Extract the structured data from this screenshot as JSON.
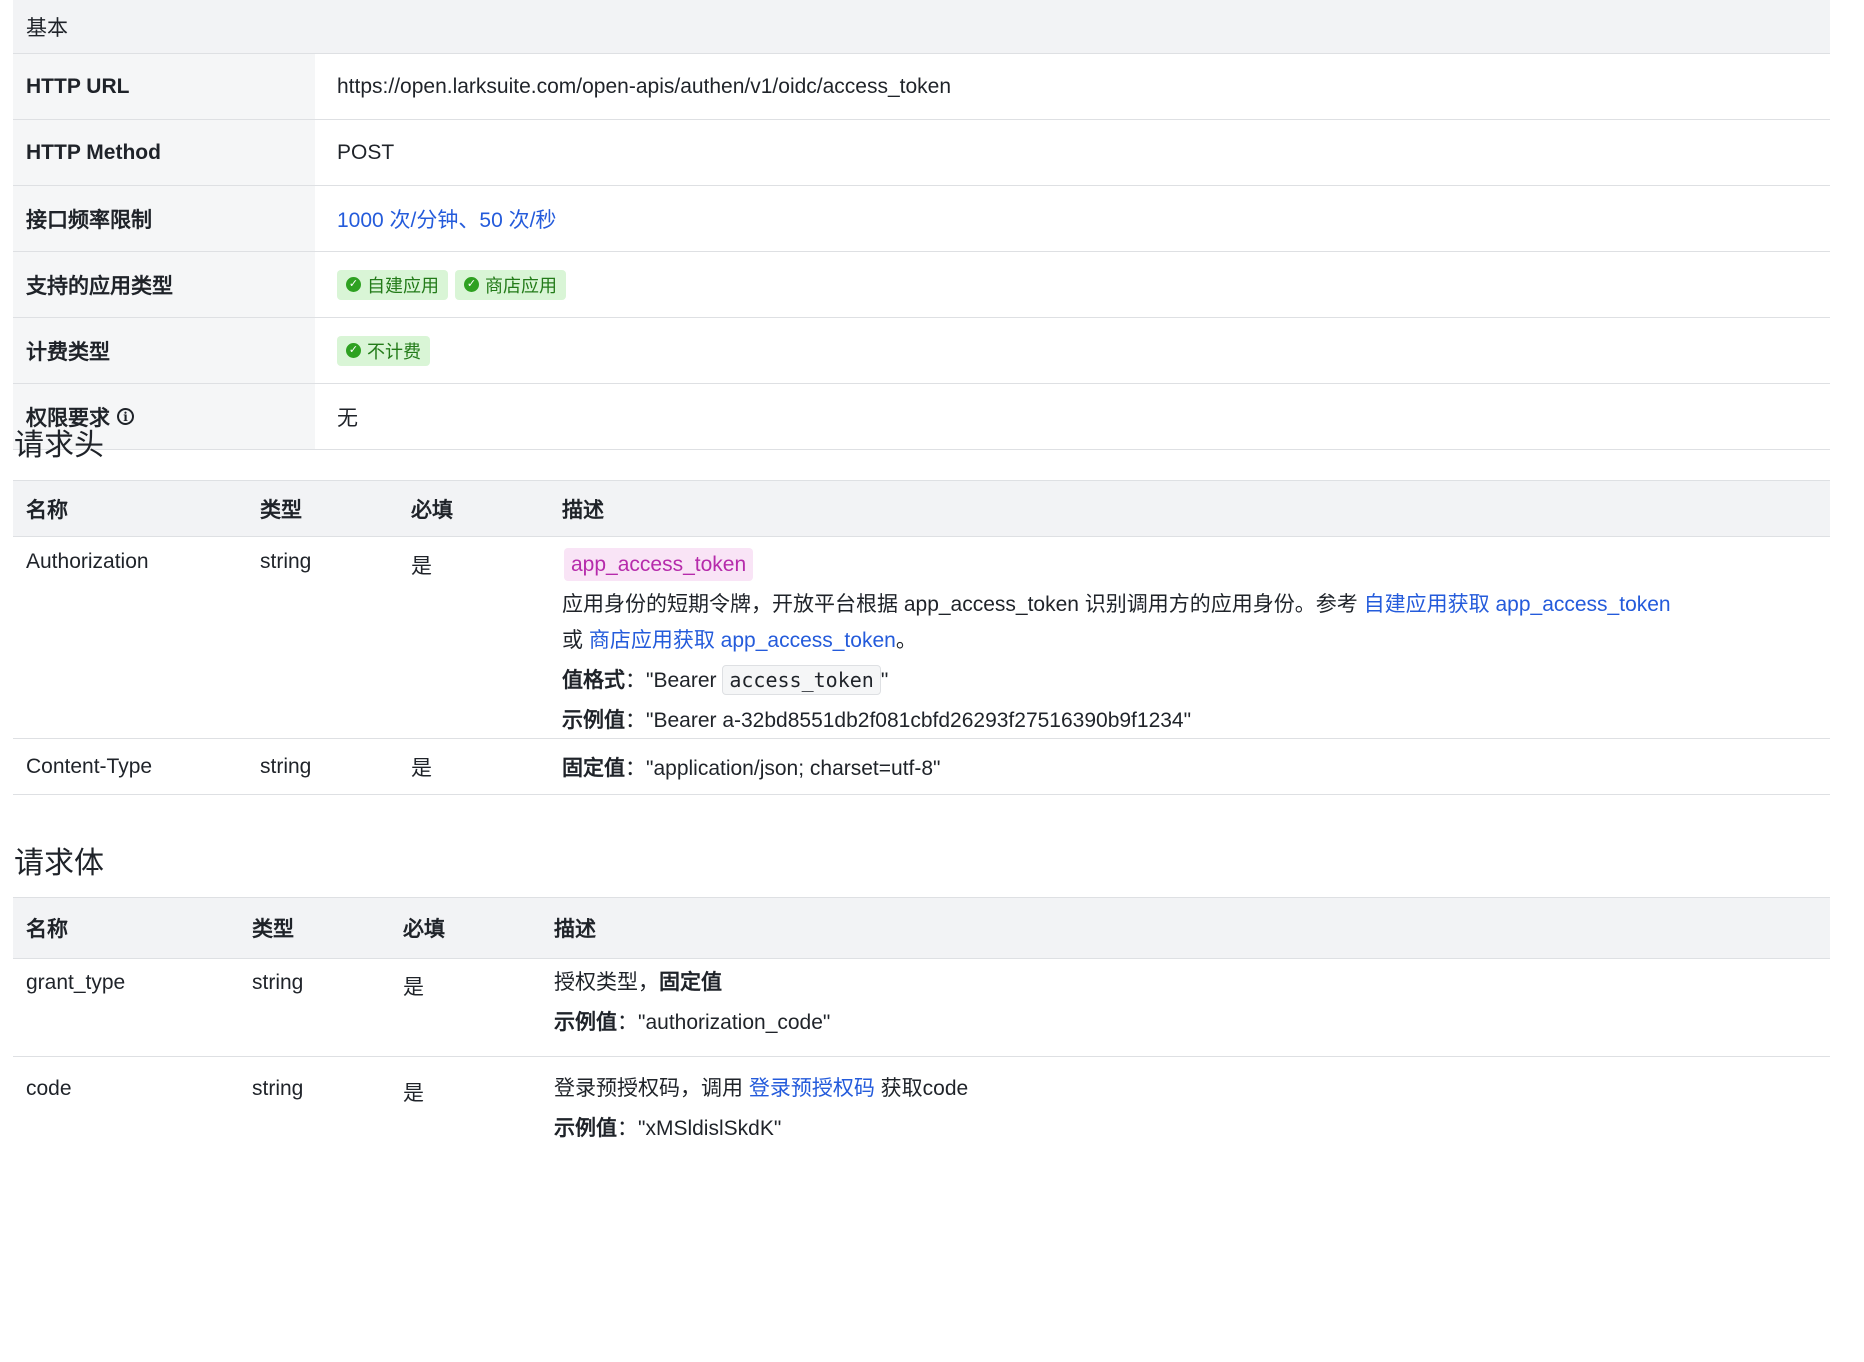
{
  "basic": {
    "header": "基本",
    "rows": [
      {
        "key": "HTTP URL",
        "value": "https://open.larksuite.com/open-apis/authen/v1/oidc/access_token"
      },
      {
        "key": "HTTP Method",
        "value": "POST"
      },
      {
        "key": "接口频率限制",
        "value": "1000 次/分钟、50 次/秒"
      },
      {
        "key": "支持的应用类型",
        "tags": [
          "自建应用",
          "商店应用"
        ]
      },
      {
        "key": "计费类型",
        "tags": [
          "不计费"
        ]
      },
      {
        "key": "权限要求",
        "value": "无"
      }
    ]
  },
  "request_header": {
    "title": "请求头",
    "columns": [
      "名称",
      "类型",
      "必填",
      "描述"
    ],
    "rows": [
      {
        "name": "Authorization",
        "type": "string",
        "required": "是",
        "chip": "app_access_token",
        "desc_line1": "应用身份的短期令牌，开放平台根据 app_access_token 识别调用方的应用身份。参考 ",
        "desc_link1": "自建应用获取 app_access_token",
        "desc_or": "或 ",
        "desc_link2": "商店应用获取 app_access_token",
        "desc_end": "。",
        "format_label": "值格式",
        "format_pre": "：\"Bearer ",
        "format_code": "access_token",
        "format_post": "\"",
        "example_label": "示例值",
        "example_value": "：\"Bearer a-32bd8551db2f081cbfd26293f27516390b9f1234\""
      },
      {
        "name": "Content-Type",
        "type": "string",
        "required": "是",
        "fixed_label": "固定值",
        "fixed_value": "：\"application/json; charset=utf-8\""
      }
    ]
  },
  "request_body": {
    "title": "请求体",
    "columns": [
      "名称",
      "类型",
      "必填",
      "描述"
    ],
    "rows": [
      {
        "name": "grant_type",
        "type": "string",
        "required": "是",
        "desc_pre": "授权类型，",
        "desc_bold": "固定值",
        "example_label": "示例值",
        "example_value": "：\"authorization_code\""
      },
      {
        "name": "code",
        "type": "string",
        "required": "是",
        "desc_pre": "登录预授权码，调用 ",
        "desc_link": "登录预授权码",
        "desc_post": " 获取code",
        "example_label": "示例值",
        "example_value": "：\"xMSldislSkdK\""
      }
    ]
  }
}
